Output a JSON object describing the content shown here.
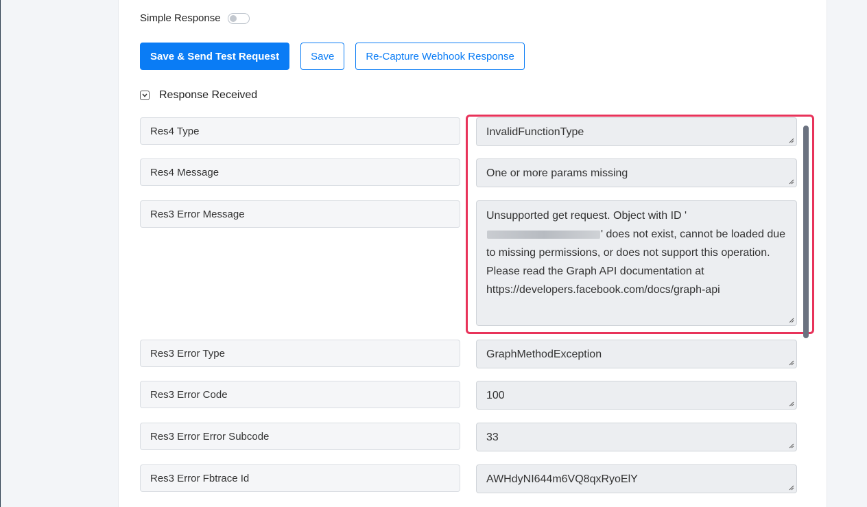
{
  "simple_response": {
    "label": "Simple Response",
    "enabled": false
  },
  "buttons": {
    "save_send": "Save & Send Test Request",
    "save": "Save",
    "recapture": "Re-Capture Webhook Response"
  },
  "response": {
    "header": "Response Received",
    "rows": [
      {
        "label": "Res4 Type",
        "value": "InvalidFunctionType"
      },
      {
        "label": "Res4 Message",
        "value": "One or more params missing"
      },
      {
        "label": "Res3 Error Message",
        "value_prefix": "Unsupported get request. Object with ID '",
        "value_suffix": "' does not exist, cannot be loaded due to missing permissions, or does not support this operation. Please read the Graph API documentation at https://developers.facebook.com/docs/graph-api"
      },
      {
        "label": "Res3 Error Type",
        "value": "GraphMethodException"
      },
      {
        "label": "Res3 Error Code",
        "value": "100"
      },
      {
        "label": "Res3 Error Error Subcode",
        "value": "33"
      },
      {
        "label": "Res3 Error Fbtrace Id",
        "value": "AWHdyNI644m6VQ8qxRyoElY"
      }
    ]
  },
  "colors": {
    "primary": "#0a7cf5",
    "highlight": "#e8335a"
  }
}
